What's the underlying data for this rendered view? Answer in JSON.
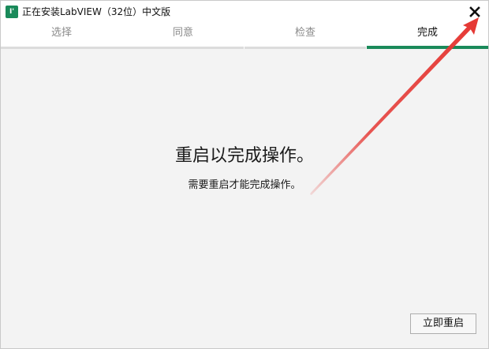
{
  "window": {
    "title": "正在安装LabVIEW（32位）中文版",
    "app_icon_glyph": "I'",
    "close_glyph": "✕"
  },
  "steps": [
    {
      "label": "选择",
      "active": false
    },
    {
      "label": "同意",
      "active": false
    },
    {
      "label": "检查",
      "active": false
    },
    {
      "label": "完成",
      "active": true
    }
  ],
  "main": {
    "headline": "重启以完成操作。",
    "subline": "需要重启才能完成操作。",
    "restart_button": "立即重启"
  },
  "colors": {
    "accent": "#1a8a5a",
    "annotation_arrow": "#e53935"
  },
  "icons": {
    "close": "close-icon",
    "app": "labview-app-icon",
    "annotation": "red-arrow-annotation"
  }
}
